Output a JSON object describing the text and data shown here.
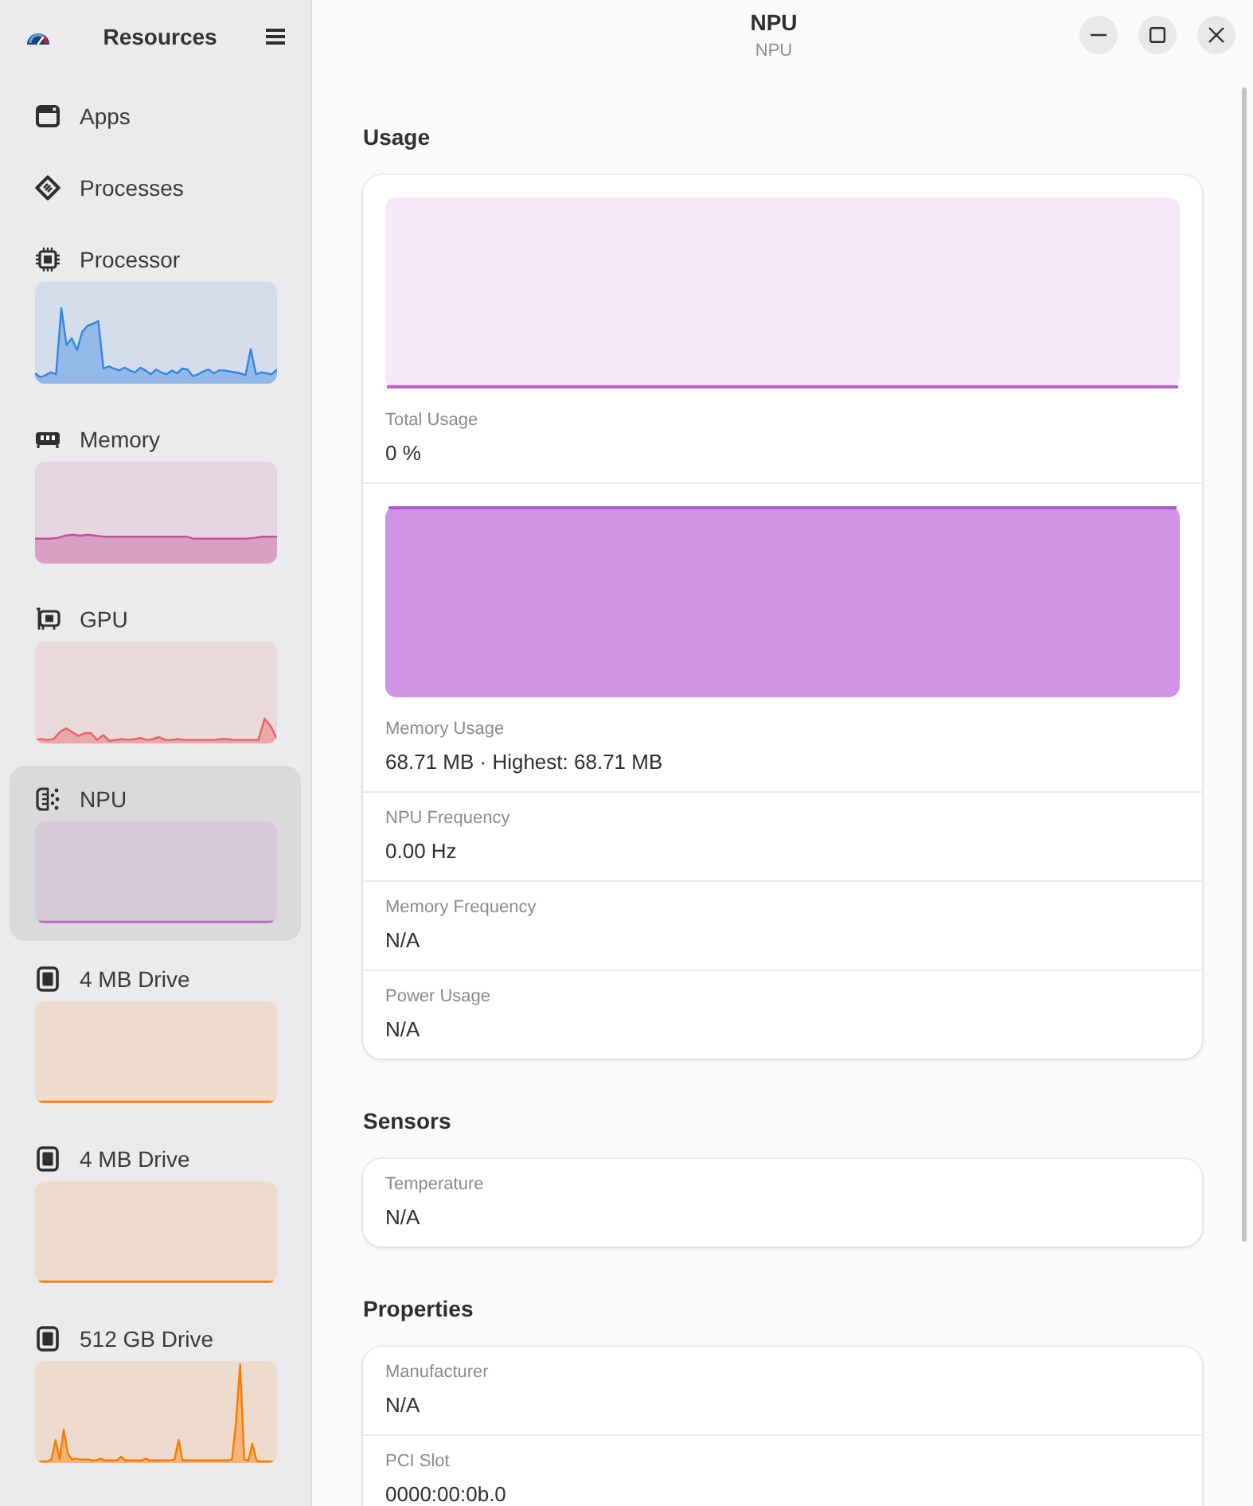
{
  "sidebar": {
    "title": "Resources",
    "items": [
      {
        "label": "Apps",
        "kind": "page",
        "selected": false
      },
      {
        "label": "Processes",
        "kind": "page",
        "selected": false
      },
      {
        "label": "Processor",
        "kind": "monitor",
        "color": "#3584e4",
        "selected": false
      },
      {
        "label": "Memory",
        "kind": "monitor",
        "color": "#c64f9b",
        "selected": false
      },
      {
        "label": "GPU",
        "kind": "monitor",
        "color": "#e66163",
        "selected": false
      },
      {
        "label": "NPU",
        "kind": "monitor",
        "color": "#c061cb",
        "selected": true
      },
      {
        "label": "4 MB Drive",
        "kind": "monitor",
        "color": "#ff7800",
        "selected": false
      },
      {
        "label": "4 MB Drive",
        "kind": "monitor",
        "color": "#ff7800",
        "selected": false
      },
      {
        "label": "512 GB Drive",
        "kind": "monitor",
        "color": "#ff7800",
        "selected": false
      }
    ]
  },
  "header": {
    "title": "NPU",
    "subtitle": "NPU"
  },
  "sections": [
    {
      "title": "Usage",
      "rows": [
        {
          "kind": "line-graph",
          "label": "Total Usage",
          "value": "0 %"
        },
        {
          "kind": "area-graph",
          "label": "Memory Usage",
          "value": "68.71 MB · Highest: 68.71 MB"
        },
        {
          "kind": "text",
          "label": "NPU Frequency",
          "value": "0.00 Hz"
        },
        {
          "kind": "text",
          "label": "Memory Frequency",
          "value": "N/A"
        },
        {
          "kind": "text",
          "label": "Power Usage",
          "value": "N/A"
        }
      ]
    },
    {
      "title": "Sensors",
      "rows": [
        {
          "kind": "text",
          "label": "Temperature",
          "value": "N/A"
        }
      ]
    },
    {
      "title": "Properties",
      "rows": [
        {
          "kind": "text",
          "label": "Manufacturer",
          "value": "N/A"
        },
        {
          "kind": "text",
          "label": "PCI Slot",
          "value": "0000:00:0b.0"
        }
      ]
    }
  ]
}
